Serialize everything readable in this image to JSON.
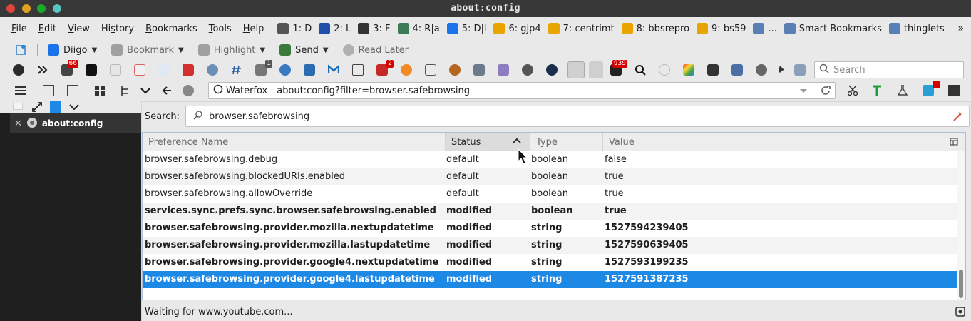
{
  "window": {
    "title": "about:config"
  },
  "menubar": {
    "items": [
      {
        "label": "File",
        "key": "F"
      },
      {
        "label": "Edit",
        "key": "E"
      },
      {
        "label": "View",
        "key": "V"
      },
      {
        "label": "History",
        "key": "s"
      },
      {
        "label": "Bookmarks",
        "key": "B"
      },
      {
        "label": "Tools",
        "key": "T"
      },
      {
        "label": "Help",
        "key": "H"
      }
    ],
    "bookmarks": [
      {
        "label": "1: D",
        "color": "#555555"
      },
      {
        "label": "2: L",
        "color": "#1f4fa8"
      },
      {
        "label": "3: F",
        "color": "#333333"
      },
      {
        "label": "4: R|a",
        "color": "#3b7a57"
      },
      {
        "label": "5: D|l",
        "color": "#1a73e8"
      },
      {
        "label": "6: gjp4",
        "color": "#e8a400"
      },
      {
        "label": "7: centrimt",
        "color": "#e8a400"
      },
      {
        "label": "8: bbsrepro",
        "color": "#e8a400"
      },
      {
        "label": "9: bs59",
        "color": "#e8a400"
      },
      {
        "label": "...",
        "color": "#5a7fb5"
      },
      {
        "label": "Smart Bookmarks",
        "color": "#5a7fb5"
      },
      {
        "label": "thinglets",
        "color": "#5a7fb5"
      }
    ],
    "overflow": "»"
  },
  "diigo": {
    "diigo_label": "Diigo",
    "bookmark_label": "Bookmark",
    "highlight_label": "Highlight",
    "send_label": "Send",
    "readlater_label": "Read Later"
  },
  "iconbar": {
    "badge_pocket": "66",
    "badge_one": "1",
    "badge_two": "2",
    "badge_939": "939",
    "search_placeholder": "Search"
  },
  "navbar": {
    "identity": "Waterfox",
    "url": "about:config?filter=browser.safebrowsing"
  },
  "sidebar": {
    "tab_label": "about:config"
  },
  "config": {
    "search_label": "Search:",
    "search_value": "browser.safebrowsing",
    "columns": {
      "name": "Preference Name",
      "status": "Status",
      "type": "Type",
      "value": "Value"
    },
    "rows": [
      {
        "name": "browser.safebrowsing.debug",
        "status": "default",
        "type": "boolean",
        "value": "false"
      },
      {
        "name": "browser.safebrowsing.blockedURIs.enabled",
        "status": "default",
        "type": "boolean",
        "value": "true"
      },
      {
        "name": "browser.safebrowsing.allowOverride",
        "status": "default",
        "type": "boolean",
        "value": "true"
      },
      {
        "name": "services.sync.prefs.sync.browser.safebrowsing.enabled",
        "status": "modified",
        "type": "boolean",
        "value": "true"
      },
      {
        "name": "browser.safebrowsing.provider.mozilla.nextupdatetime",
        "status": "modified",
        "type": "string",
        "value": "1527594239405"
      },
      {
        "name": "browser.safebrowsing.provider.mozilla.lastupdatetime",
        "status": "modified",
        "type": "string",
        "value": "1527590639405"
      },
      {
        "name": "browser.safebrowsing.provider.google4.nextupdatetime",
        "status": "modified",
        "type": "string",
        "value": "1527593199235"
      },
      {
        "name": "browser.safebrowsing.provider.google4.lastupdatetime",
        "status": "modified",
        "type": "string",
        "value": "1527591387235"
      }
    ],
    "selected_index": 7
  },
  "status": {
    "text": "Waiting for www.youtube.com..."
  },
  "colors": {
    "selection": "#1e88e5",
    "titlebar": "#383838",
    "sidebar": "#1f1f1f"
  }
}
